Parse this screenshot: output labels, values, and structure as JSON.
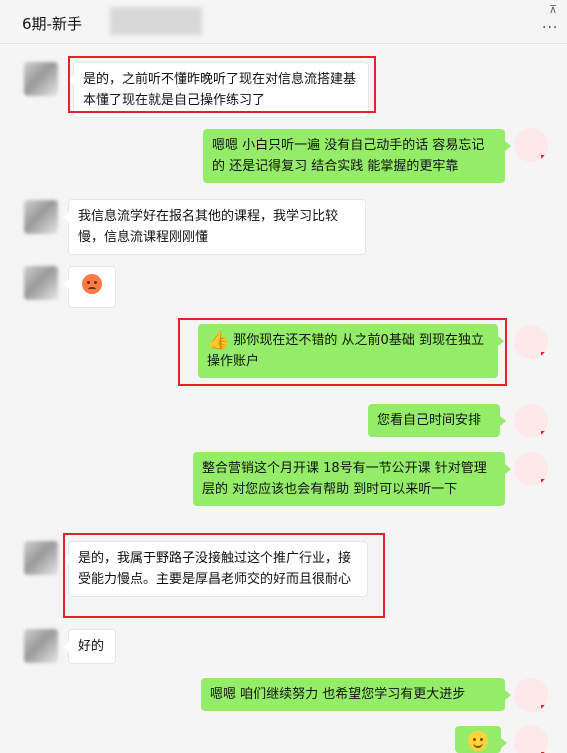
{
  "header": {
    "title": "6期-新手",
    "pin_icon": "pin-icon",
    "more_icon": "more-icon",
    "more_glyph": "···",
    "pin_glyph": "⊼"
  },
  "messages": [
    {
      "side": "left",
      "text": "是的，之前听不懂昨晚听了现在对信息流搭建基本懂了现在就是自己操作练习了",
      "highlighted": true
    },
    {
      "side": "right",
      "text": "嗯嗯 小白只听一遍 没有自己动手的话  容易忘记的  还是记得复习 结合实践 能掌握的更牢靠",
      "highlighted": false
    },
    {
      "side": "left",
      "text": "我信息流学好在报名其他的课程，我学习比较慢，信息流课程刚刚懂",
      "highlighted": false
    },
    {
      "side": "left",
      "text": "",
      "emoji": "frowning-face-emoji",
      "highlighted": false
    },
    {
      "side": "right",
      "text": "那你现在还不错的 从之前0基础  到现在独立操作账户",
      "emoji": "thumbs-up-emoji",
      "highlighted": true
    },
    {
      "side": "right",
      "text": "您看自己时间安排",
      "highlighted": false
    },
    {
      "side": "right",
      "text": "整合营销这个月开课  18号有一节公开课 针对管理层的  对您应该也会有帮助 到时可以来听一下",
      "highlighted": false
    },
    {
      "side": "left",
      "text": "是的，我属于野路子没接触过这个推广行业，接受能力慢点。主要是厚昌老师交的好而且很耐心",
      "highlighted": true
    },
    {
      "side": "left",
      "text": "好的",
      "highlighted": false
    },
    {
      "side": "right",
      "text": "嗯嗯  咱们继续努力  也希望您学习有更大进步",
      "highlighted": false
    },
    {
      "side": "right",
      "text": "",
      "emoji": "smile-emoji",
      "highlighted": false
    }
  ],
  "colors": {
    "accent_green": "#95ec69",
    "highlight_red": "#e8202a",
    "background": "#f5f5f5"
  }
}
